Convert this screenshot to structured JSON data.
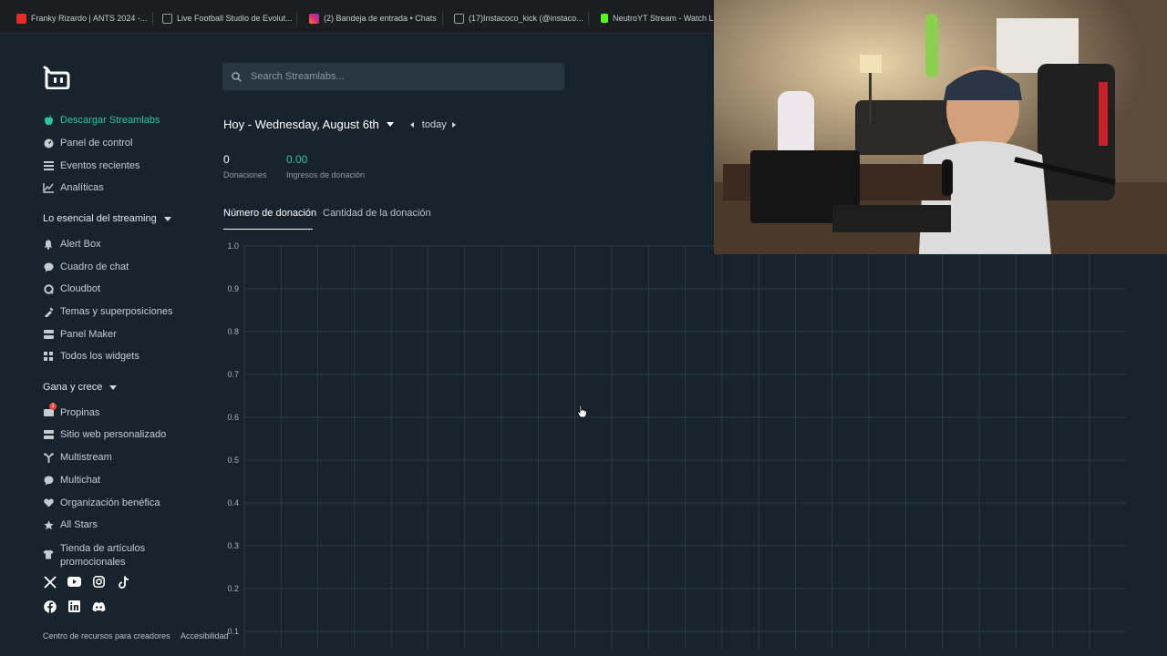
{
  "browser": {
    "bookmarks": [
      {
        "label": "Franky Rizardo | ANTS 2024 -...",
        "color": "#e52d27"
      },
      {
        "label": "Live Football Studio de Evolut...",
        "color": "#9aa0a6"
      },
      {
        "label": "(2) Bandeja de entrada • Chats",
        "color": "#d6249f"
      },
      {
        "label": "(17)Instacoco_kick (@instaco...",
        "color": "#9aa0a6"
      },
      {
        "label": "NeutroYT Stream - Watch Liv",
        "color": "#53fc18"
      }
    ]
  },
  "sidebar": {
    "top_items": [
      {
        "label": "Descargar Streamlabs",
        "icon": "apple-icon",
        "active": true
      },
      {
        "label": "Panel de control",
        "icon": "dashboard-icon"
      },
      {
        "label": "Eventos recientes",
        "icon": "list-icon"
      },
      {
        "label": "Analíticas",
        "icon": "analytics-icon"
      }
    ],
    "section1": {
      "title": "Lo esencial del streaming",
      "items": [
        {
          "label": "Alert Box",
          "icon": "bell-icon"
        },
        {
          "label": "Cuadro de chat",
          "icon": "chat-icon"
        },
        {
          "label": "Cloudbot",
          "icon": "cloudbot-icon"
        },
        {
          "label": "Temas y superposiciones",
          "icon": "themes-icon"
        },
        {
          "label": "Panel Maker",
          "icon": "panel-icon"
        },
        {
          "label": "Todos los widgets",
          "icon": "widgets-icon"
        }
      ]
    },
    "section2": {
      "title": "Gana y crece",
      "items": [
        {
          "label": "Propinas",
          "icon": "tips-icon"
        },
        {
          "label": "Sitio web personalizado",
          "icon": "website-icon"
        },
        {
          "label": "Multistream",
          "icon": "multistream-icon"
        },
        {
          "label": "Multichat",
          "icon": "multichat-icon"
        },
        {
          "label": "Organización benéfica",
          "icon": "heart-icon"
        },
        {
          "label": "All Stars",
          "icon": "star-icon"
        },
        {
          "label": "Tienda de artículos promocionales",
          "icon": "shirt-icon"
        }
      ]
    },
    "footer": {
      "resources": "Centro de recursos para creadores",
      "accessibility": "Accesibilidad"
    }
  },
  "main": {
    "search_placeholder": "Search Streamlabs...",
    "date_title": "Hoy - Wednesday, August 6th",
    "today_label": "today",
    "stats": [
      {
        "value": "0",
        "label": "Donaciones"
      },
      {
        "value": "0.00",
        "label": "Ingresos de donación"
      }
    ],
    "tabs": [
      "Número de donación",
      "Cantidad de la donación"
    ]
  },
  "colors": {
    "accent": "#31c3a2",
    "background": "#17242d",
    "badge": "#e74c3c"
  },
  "chart_data": {
    "type": "line",
    "series": [],
    "ylim": [
      0,
      1.0
    ],
    "yticks": [
      "1.0",
      "0.9",
      "0.8",
      "0.7",
      "0.6",
      "0.5",
      "0.4",
      "0.3",
      "0.2",
      "0.1"
    ],
    "grid": true
  }
}
